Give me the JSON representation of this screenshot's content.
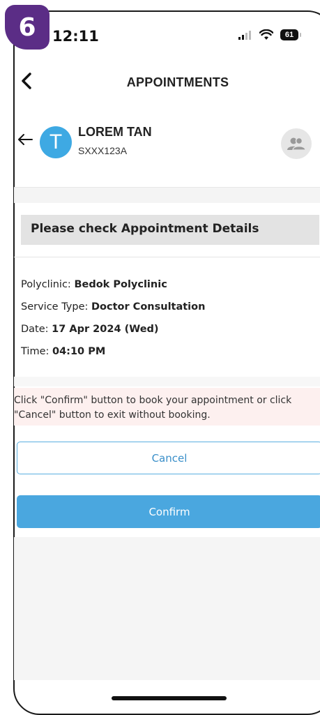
{
  "step_badge": "6",
  "status_bar": {
    "time": "12:11",
    "battery": "61"
  },
  "header": {
    "title": "APPOINTMENTS"
  },
  "profile": {
    "initial": "T",
    "name": "LOREM TAN",
    "nric": "SXXX123A"
  },
  "section": {
    "title": "Please check Appointment Details"
  },
  "details": {
    "polyclinic_label": "Polyclinic:",
    "polyclinic_value": "Bedok Polyclinic",
    "service_label": "Service Type:",
    "service_value": "Doctor Consultation",
    "date_label": "Date:",
    "date_value": "17 Apr 2024 (Wed)",
    "time_label": "Time:",
    "time_value": "04:10 PM"
  },
  "notice": {
    "text": "Click \"Confirm\" button to book your appointment or click \"Cancel\" button to exit without booking."
  },
  "buttons": {
    "cancel": "Cancel",
    "confirm": "Confirm"
  },
  "colors": {
    "badge": "#5b2d86",
    "accent": "#4aa7df",
    "avatar": "#3ea9e3",
    "notice_bg": "#fdf0ef"
  },
  "icons": {
    "back": "chevron-left-icon",
    "profile_back": "arrow-left-icon",
    "switch_profile": "people-icon"
  }
}
